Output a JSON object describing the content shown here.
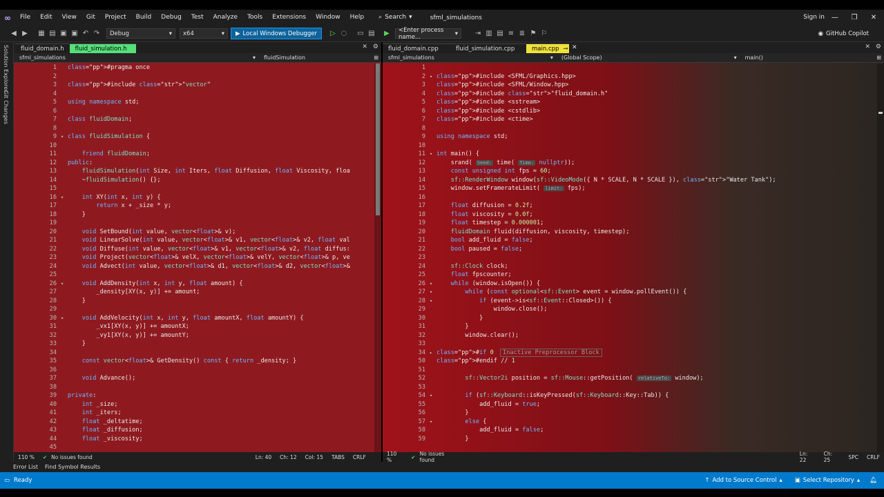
{
  "menu": {
    "items": [
      "File",
      "Edit",
      "View",
      "Git",
      "Project",
      "Build",
      "Debug",
      "Test",
      "Analyze",
      "Tools",
      "Extensions",
      "Window",
      "Help"
    ],
    "search_label": "Search",
    "solution": "sfml_simulations",
    "signin": "Sign in"
  },
  "toolbar": {
    "config": "Debug",
    "platform": "x64",
    "run_label": "Local Windows Debugger",
    "process": "<Enter process name...",
    "copilot": "GitHub Copilot"
  },
  "side": {
    "solution_explorer": "Solution Explorer",
    "git_changes": "Git Changes"
  },
  "left": {
    "tabs": [
      "fluid_domain.h",
      "fluid_simulation.h"
    ],
    "nav_project": "sfml_simulations",
    "nav_scope": "fluidSimulation",
    "zoom": "110 %",
    "issues": "No issues found",
    "ln": "Ln: 40",
    "ch": "Ch: 12",
    "col": "Col: 15",
    "tabs_mode": "TABS",
    "eol": "CRLF"
  },
  "right": {
    "tabs": [
      "fluid_domain.cpp",
      "fluid_simulation.cpp",
      "main.cpp"
    ],
    "nav_project": "sfml_simulations",
    "nav_scope": "(Global Scope)",
    "nav_fn": "main()",
    "zoom": "110 %",
    "issues": "No issues found",
    "ln": "Ln: 22",
    "ch": "Ch: 25",
    "spc": "SPC",
    "eol": "CRLF"
  },
  "bottom": {
    "tabs": [
      "Error List",
      "Find Symbol Results"
    ],
    "ready": "Ready",
    "add_source": "Add to Source Control",
    "select_repo": "Select Repository"
  },
  "left_code": [
    {
      "n": "1",
      "f": "",
      "t": "#pragma once"
    },
    {
      "n": "2",
      "f": "",
      "t": ""
    },
    {
      "n": "3",
      "f": "",
      "t": "#include \"vector\""
    },
    {
      "n": "4",
      "f": "",
      "t": ""
    },
    {
      "n": "5",
      "f": "",
      "t": "using namespace std;"
    },
    {
      "n": "6",
      "f": "",
      "t": ""
    },
    {
      "n": "7",
      "f": "",
      "t": "class fluidDomain;"
    },
    {
      "n": "8",
      "f": "",
      "t": ""
    },
    {
      "n": "9",
      "f": "▾",
      "t": "class fluidSimulation {"
    },
    {
      "n": "10",
      "f": "",
      "t": ""
    },
    {
      "n": "11",
      "f": "",
      "t": "    friend fluidDomain;"
    },
    {
      "n": "12",
      "f": "",
      "t": "public:"
    },
    {
      "n": "13",
      "f": "",
      "t": "    fluidSimulation(int Size, int Iters, float Diffusion, float Viscosity, floa"
    },
    {
      "n": "14",
      "f": "",
      "t": "    ~fluidSimulation() {};"
    },
    {
      "n": "15",
      "f": "",
      "t": ""
    },
    {
      "n": "16",
      "f": "▾",
      "t": "    int XY(int x, int y) {"
    },
    {
      "n": "17",
      "f": "",
      "t": "        return x + _size * y;"
    },
    {
      "n": "18",
      "f": "",
      "t": "    }"
    },
    {
      "n": "19",
      "f": "",
      "t": ""
    },
    {
      "n": "20",
      "f": "",
      "t": "    void SetBound(int value, vector<float>& v);"
    },
    {
      "n": "21",
      "f": "",
      "t": "    void LinearSolve(int value, vector<float>& v1, vector<float>& v2, float val"
    },
    {
      "n": "22",
      "f": "",
      "t": "    void Diffuse(int value, vector<float>& v1, vector<float>& v2, float diffus:"
    },
    {
      "n": "23",
      "f": "",
      "t": "    void Project(vector<float>& velX, vector<float>& velY, vector<float>& p, ve"
    },
    {
      "n": "24",
      "f": "",
      "t": "    void Advect(int value, vector<float>& d1, vector<float>& d2, vector<float>&"
    },
    {
      "n": "25",
      "f": "",
      "t": ""
    },
    {
      "n": "26",
      "f": "▾",
      "t": "    void AddDensity(int x, int y, float amount) {"
    },
    {
      "n": "27",
      "f": "",
      "t": "        _density[XY(x, y)] += amount;"
    },
    {
      "n": "28",
      "f": "",
      "t": "    }"
    },
    {
      "n": "29",
      "f": "",
      "t": ""
    },
    {
      "n": "30",
      "f": "▾",
      "t": "    void AddVelocity(int x, int y, float amountX, float amountY) {"
    },
    {
      "n": "31",
      "f": "",
      "t": "        _vx1[XY(x, y)] += amountX;"
    },
    {
      "n": "32",
      "f": "",
      "t": "        _vy1[XY(x, y)] += amountY;"
    },
    {
      "n": "33",
      "f": "",
      "t": "    }"
    },
    {
      "n": "34",
      "f": "",
      "t": ""
    },
    {
      "n": "35",
      "f": "",
      "t": "    const vector<float>& GetDensity() const { return _density; }"
    },
    {
      "n": "36",
      "f": "",
      "t": ""
    },
    {
      "n": "37",
      "f": "",
      "t": "    void Advance();"
    },
    {
      "n": "38",
      "f": "",
      "t": ""
    },
    {
      "n": "39",
      "f": "",
      "t": "private:"
    },
    {
      "n": "40",
      "f": "",
      "t": "    int _size;"
    },
    {
      "n": "41",
      "f": "",
      "t": "    int _iters;"
    },
    {
      "n": "42",
      "f": "",
      "t": "    float _deltatime;"
    },
    {
      "n": "43",
      "f": "",
      "t": "    float _diffusion;"
    },
    {
      "n": "44",
      "f": "",
      "t": "    float _viscosity;"
    },
    {
      "n": "45",
      "f": "",
      "t": ""
    }
  ],
  "right_code": [
    {
      "n": "1",
      "f": "",
      "t": ""
    },
    {
      "n": "2",
      "f": "▾",
      "t": "#include <SFML/Graphics.hpp>"
    },
    {
      "n": "3",
      "f": "",
      "t": "#include <SFML/Window.hpp>"
    },
    {
      "n": "4",
      "f": "",
      "t": "#include \"fluid_domain.h\""
    },
    {
      "n": "5",
      "f": "",
      "t": "#include <sstream>"
    },
    {
      "n": "6",
      "f": "",
      "t": "#include <cstdlib>"
    },
    {
      "n": "7",
      "f": "",
      "t": "#include <ctime>"
    },
    {
      "n": "8",
      "f": "",
      "t": ""
    },
    {
      "n": "9",
      "f": "",
      "t": "using namespace std;"
    },
    {
      "n": "10",
      "f": "",
      "t": ""
    },
    {
      "n": "11",
      "f": "▾",
      "t": "int main() {"
    },
    {
      "n": "12",
      "f": "",
      "t": "    srand( Seed: time( Time: nullptr));"
    },
    {
      "n": "13",
      "f": "",
      "t": "    const unsigned int fps = 60;"
    },
    {
      "n": "14",
      "f": "",
      "t": "    sf::RenderWindow window(sf::VideoMode({ N * SCALE, N * SCALE }), \"Water Tank\");"
    },
    {
      "n": "15",
      "f": "",
      "t": "    window.setFramerateLimit( limit: fps);"
    },
    {
      "n": "16",
      "f": "",
      "t": ""
    },
    {
      "n": "17",
      "f": "",
      "t": "    float diffusion = 0.2f;"
    },
    {
      "n": "18",
      "f": "",
      "t": "    float viscosity = 0.0f;"
    },
    {
      "n": "19",
      "f": "",
      "t": "    float timestep = 0.000001;"
    },
    {
      "n": "20",
      "f": "",
      "t": "    fluidDomain fluid(diffusion, viscosity, timestep);"
    },
    {
      "n": "21",
      "f": "",
      "t": "    bool add_fluid = false;"
    },
    {
      "n": "22",
      "f": "",
      "t": "    bool paused = false;"
    },
    {
      "n": "23",
      "f": "",
      "t": ""
    },
    {
      "n": "24",
      "f": "",
      "t": "    sf::Clock clock;"
    },
    {
      "n": "25",
      "f": "",
      "t": "    float fpscounter;"
    },
    {
      "n": "26",
      "f": "▾",
      "t": "    while (window.isOpen()) {"
    },
    {
      "n": "27",
      "f": "▾",
      "t": "        while (const optional<sf::Event> event = window.pollEvent()) {"
    },
    {
      "n": "28",
      "f": "▾",
      "t": "            if (event->is<sf::Event::Closed>()) {"
    },
    {
      "n": "29",
      "f": "",
      "t": "                window.close();"
    },
    {
      "n": "30",
      "f": "",
      "t": "            }"
    },
    {
      "n": "31",
      "f": "",
      "t": "        }"
    },
    {
      "n": "32",
      "f": "",
      "t": "        window.clear();"
    },
    {
      "n": "33",
      "f": "",
      "t": ""
    },
    {
      "n": "34",
      "f": "▸",
      "t": "#if 0 Inactive Preprocessor Block"
    },
    {
      "n": "50",
      "f": "",
      "t": "#endif // 1"
    },
    {
      "n": "51",
      "f": "",
      "t": ""
    },
    {
      "n": "52",
      "f": "",
      "t": "        sf::Vector2i position = sf::Mouse::getPosition( relativeTo: window);"
    },
    {
      "n": "53",
      "f": "",
      "t": ""
    },
    {
      "n": "54",
      "f": "▾",
      "t": "        if (sf::Keyboard::isKeyPressed(sf::Keyboard::Key::Tab)) {"
    },
    {
      "n": "55",
      "f": "",
      "t": "            add_fluid = true;"
    },
    {
      "n": "56",
      "f": "",
      "t": "        }"
    },
    {
      "n": "57",
      "f": "▾",
      "t": "        else {"
    },
    {
      "n": "58",
      "f": "",
      "t": "            add_fluid = false;"
    },
    {
      "n": "59",
      "f": "",
      "t": "        }"
    }
  ]
}
